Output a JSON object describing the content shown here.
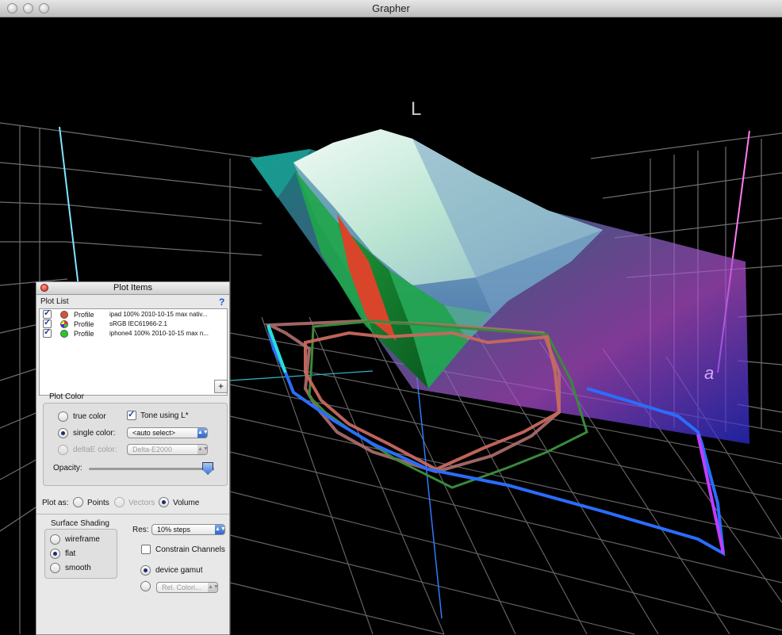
{
  "window": {
    "title": "Grapher"
  },
  "scene": {
    "axis_l": "L",
    "axis_a": "a"
  },
  "palette": {
    "title": "Plot Items",
    "plot_list_label": "Plot List",
    "help": "?",
    "items": [
      {
        "type": "Profile",
        "name": "ipad 100% 2010-10-15 max nativ...",
        "color": "#e0502e",
        "checked": true
      },
      {
        "type": "Profile",
        "name": "sRGB IEC61966-2.1",
        "color": "multicolor",
        "checked": true
      },
      {
        "type": "Profile",
        "name": "iphone4 100% 2010-10-15 max n...",
        "color": "#22cc22",
        "checked": true
      }
    ],
    "add_button": "+",
    "plot_color": {
      "label": "Plot Color",
      "true_color": "true color",
      "tone": "Tone using L*",
      "single_color": "single color:",
      "single_value": "<auto select>",
      "deltae_color": "deltaE color:",
      "deltae_value": "Delta-E2000",
      "opacity": "Opacity:",
      "opacity_value": 0.95
    },
    "plot_as": {
      "label": "Plot as:",
      "points": "Points",
      "vectors": "Vectors",
      "volume": "Volume"
    },
    "surface": {
      "label": "Surface Shading",
      "wireframe": "wireframe",
      "flat": "flat",
      "smooth": "smooth"
    },
    "res": {
      "label": "Res:",
      "value": "10% steps"
    },
    "constrain": "Constrain Channels",
    "device_gamut": "device gamut",
    "rel_color": "Rel. Colori..."
  }
}
